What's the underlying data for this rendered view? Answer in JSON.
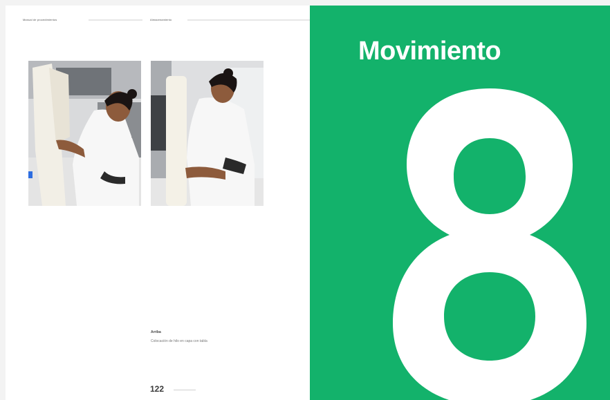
{
  "left_page": {
    "header_left": "Manual de procedimientos",
    "header_right": "Almacenamiento",
    "caption": {
      "title": "Arriba",
      "text": "Colocación de hilo en capa con tabla"
    },
    "page_number": "122"
  },
  "right_page": {
    "chapter_title": "Movimiento",
    "chapter_number": "8",
    "background_color": "#13b26b"
  },
  "photos": [
    {
      "name": "worker-unrolling-paper-photo",
      "icon": "photo"
    },
    {
      "name": "worker-rolling-paper-photo",
      "icon": "photo"
    }
  ]
}
